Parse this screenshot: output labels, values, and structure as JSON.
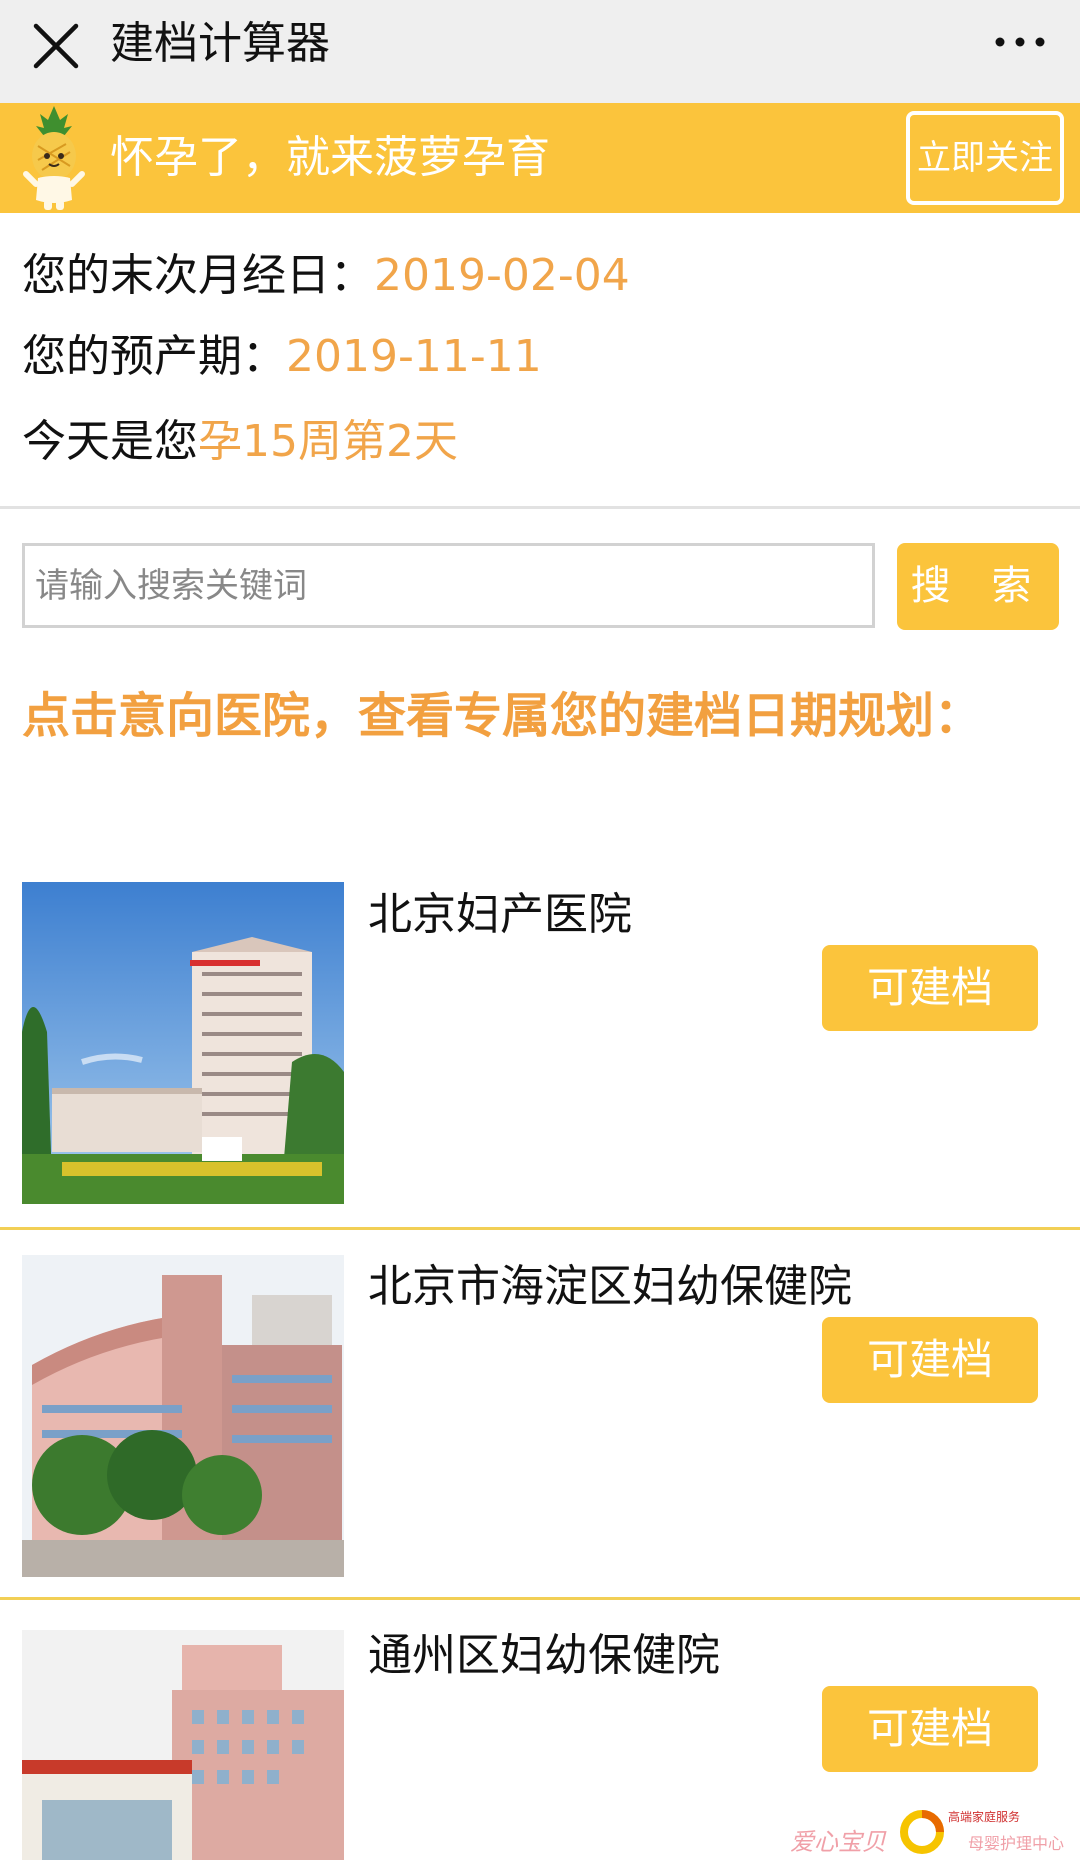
{
  "header": {
    "title": "建档计算器"
  },
  "banner": {
    "slogan": "怀孕了，就来菠萝孕育",
    "follow_label": "立即关注"
  },
  "info": {
    "last_period_label": "您的末次月经日：",
    "last_period_value": "2019-02-04",
    "due_date_label": "您的预产期：",
    "due_date_value": "2019-11-11",
    "today_label": "今天是您",
    "today_value": "孕15周第2天"
  },
  "search": {
    "placeholder": "请输入搜索关键词",
    "button_label": "搜 索"
  },
  "instruction": "点击意向医院，查看专属您的建档日期规划：",
  "hospitals": [
    {
      "name": "北京妇产医院",
      "button": "可建档"
    },
    {
      "name": "北京市海淀区妇幼保健院",
      "button": "可建档"
    },
    {
      "name": "通州区妇幼保健院",
      "button": "可建档"
    }
  ],
  "watermark": {
    "brand": "爱心宝贝",
    "service": "高端家庭服务",
    "center": "母婴护理中心"
  },
  "colors": {
    "accent": "#fbc43c",
    "highlight": "#f1a54a",
    "topbar": "#efefef"
  }
}
